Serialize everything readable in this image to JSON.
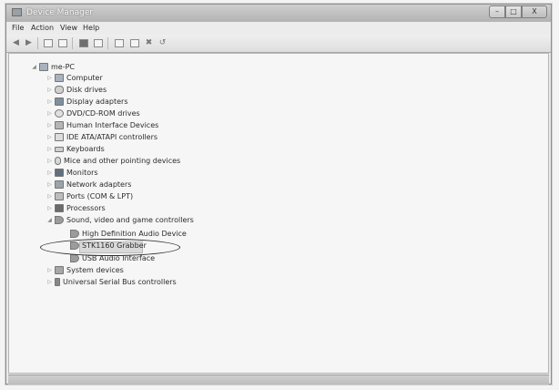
{
  "window": {
    "title": "Device Manager",
    "buttons": {
      "minimize": "–",
      "maximize": "□",
      "close": "X"
    }
  },
  "menu": [
    "File",
    "Action",
    "View",
    "Help"
  ],
  "toolbar": {
    "icons": [
      "back-arrow-icon",
      "forward-arrow-icon",
      "show-hide-tree-icon",
      "properties-icon",
      "help-icon",
      "view-icon",
      "scan-hardware-icon",
      "update-driver-icon",
      "uninstall-icon",
      "disable-icon"
    ]
  },
  "tree": {
    "root": "me-PC",
    "categories": [
      "Computer",
      "Disk drives",
      "Display adapters",
      "DVD/CD-ROM drives",
      "Human Interface Devices",
      "IDE ATA/ATAPI controllers",
      "Keyboards",
      "Mice and other pointing devices",
      "Monitors",
      "Network adapters",
      "Ports (COM & LPT)",
      "Processors",
      "Sound, video and game controllers"
    ],
    "sound_children": [
      "High Definition Audio Device",
      "STK1160 Grabber",
      "USB Audio Interface"
    ],
    "after_categories": [
      "System devices",
      "Universal Serial Bus controllers"
    ]
  }
}
